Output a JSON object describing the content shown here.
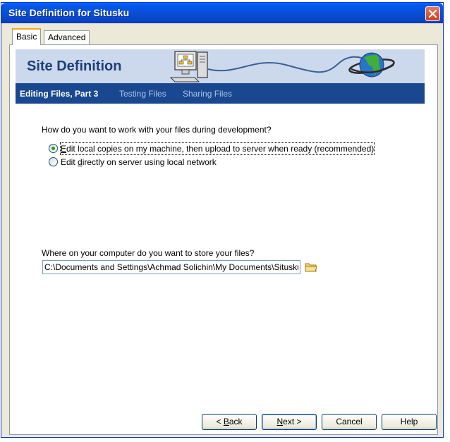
{
  "window": {
    "title": "Site Definition for Situsku",
    "close_icon": "close-icon"
  },
  "tabs": [
    {
      "label": "Basic",
      "active": true
    },
    {
      "label": "Advanced",
      "active": false
    }
  ],
  "banner": {
    "title": "Site Definition",
    "steps": [
      {
        "label": "Editing Files, Part 3",
        "current": true
      },
      {
        "label": "Testing Files",
        "current": false
      },
      {
        "label": "Sharing Files",
        "current": false
      }
    ],
    "graphic_icons": [
      "computer-icon",
      "globe-icon"
    ],
    "colors": {
      "banner_light": "#ccd8ec",
      "banner_dark": "#1a4890",
      "title_text": "#1e3f78"
    }
  },
  "question": "How do you want to work with your files during development?",
  "options": [
    {
      "pre": "",
      "accel": "E",
      "post": "dit local copies on my machine, then upload to server when ready (recommended)",
      "selected": true
    },
    {
      "pre": "Edit ",
      "accel": "d",
      "post": "irectly on server using local network",
      "selected": false
    }
  ],
  "storage": {
    "label": "Where on your computer do you want to store your files?",
    "path_value": "C:\\Documents and Settings\\Achmad Solichin\\My Documents\\Situsku\\",
    "browse_icon": "folder-icon"
  },
  "buttons": {
    "back": {
      "pre": "< ",
      "accel": "B",
      "post": "ack"
    },
    "next": {
      "pre": "",
      "accel": "N",
      "post": "ext >"
    },
    "cancel": "Cancel",
    "help": "Help"
  }
}
